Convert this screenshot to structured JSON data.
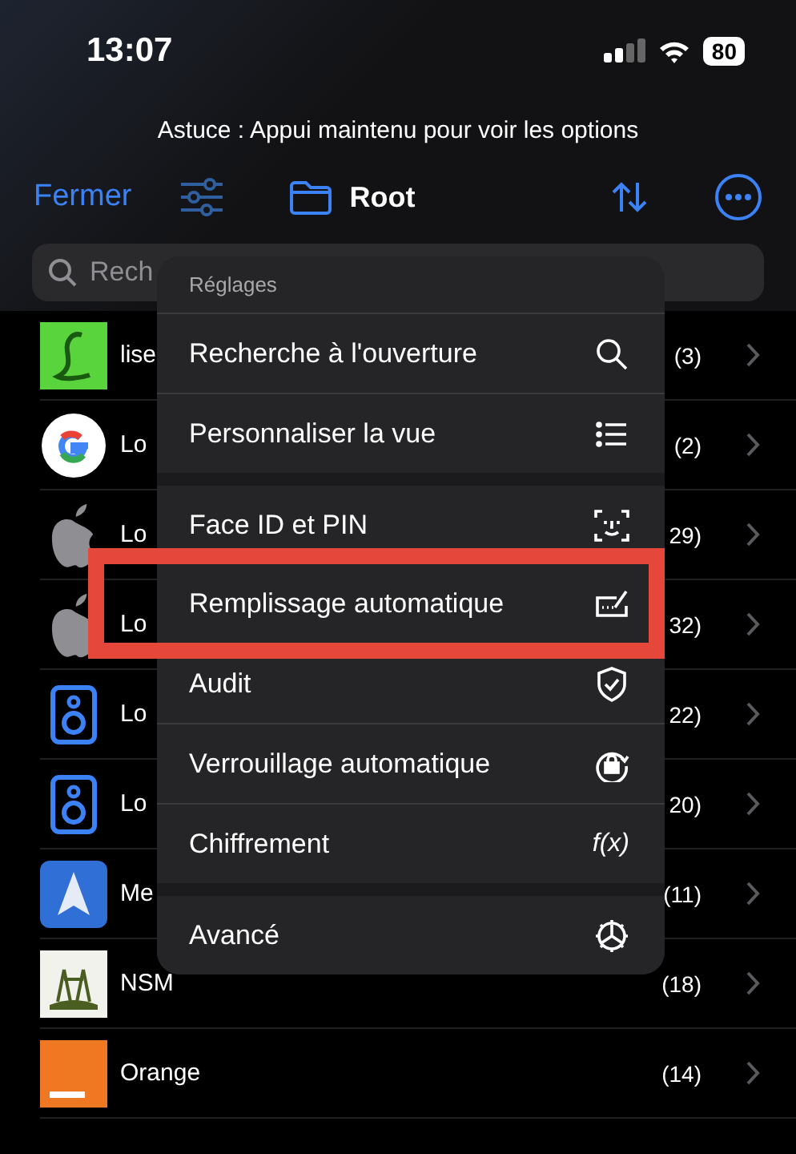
{
  "status_bar": {
    "time": "13:07",
    "battery": "80"
  },
  "tip": "Astuce : Appui maintenu pour voir les options",
  "toolbar": {
    "close": "Fermer",
    "title": "Root"
  },
  "search": {
    "placeholder": "Rech"
  },
  "rows": [
    {
      "kind": "letter",
      "name": "lise",
      "count": "(3)"
    },
    {
      "kind": "google",
      "name": "Lo",
      "count": "(2)"
    },
    {
      "kind": "apple",
      "name": "Lo",
      "count": "29)"
    },
    {
      "kind": "apple",
      "name": "Lo",
      "count": "32)"
    },
    {
      "kind": "speaker",
      "name": "Lo",
      "count": "22)"
    },
    {
      "kind": "speaker",
      "name": "Lo",
      "count": "20)"
    },
    {
      "kind": "arrow",
      "name": "Me",
      "count": "(11)"
    },
    {
      "kind": "figures",
      "name": "NSM",
      "count": "(18)"
    },
    {
      "kind": "square",
      "name": "Orange",
      "count": "(14)"
    }
  ],
  "menu": {
    "header": "Réglages",
    "groups": [
      {
        "items": [
          {
            "label": "Recherche à l'ouverture",
            "kind": "search",
            "highlighted": false
          },
          {
            "label": "Personnaliser la vue",
            "kind": "list",
            "highlighted": false
          }
        ]
      },
      {
        "items": [
          {
            "label": "Face ID et PIN",
            "kind": "faceid",
            "highlighted": false
          },
          {
            "label": "Remplissage automatique",
            "kind": "autofill",
            "highlighted": true
          },
          {
            "label": "Audit",
            "kind": "shield",
            "highlighted": false
          },
          {
            "label": "Verrouillage automatique",
            "kind": "lock",
            "highlighted": false
          },
          {
            "label": "Chiffrement",
            "kind": "text",
            "glyph": "f(x)",
            "highlighted": false
          }
        ]
      },
      {
        "items": [
          {
            "label": "Avancé",
            "kind": "gear",
            "highlighted": false
          }
        ]
      }
    ]
  }
}
